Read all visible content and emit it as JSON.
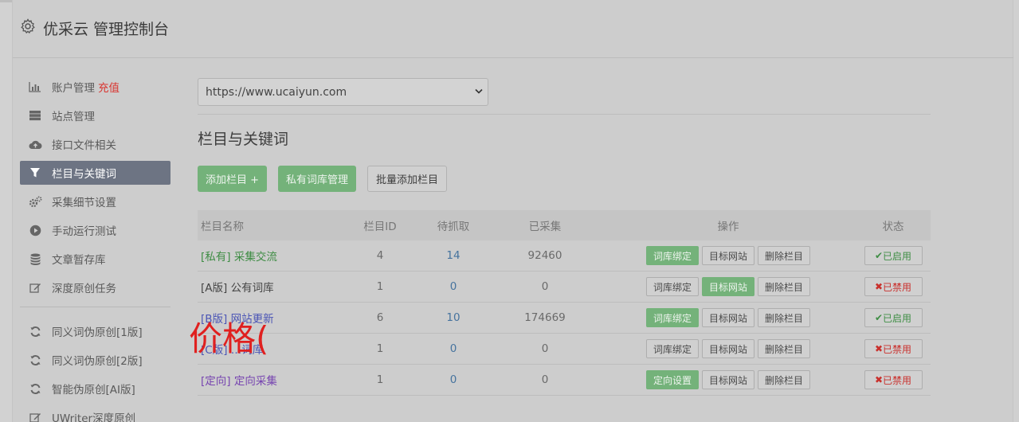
{
  "header": {
    "title": "优采云 管理控制台",
    "icon": "gear-icon"
  },
  "sidebar": {
    "items": [
      {
        "label": "账户管理",
        "extra": "充值",
        "icon": "bar-chart-icon"
      },
      {
        "label": "站点管理",
        "icon": "server-icon"
      },
      {
        "label": "接口文件相关",
        "icon": "cloud-upload-icon"
      },
      {
        "label": "栏目与关键词",
        "icon": "filter-icon",
        "active": true
      },
      {
        "label": "采集细节设置",
        "icon": "cogs-icon"
      },
      {
        "label": "手动运行测试",
        "icon": "play-circle-icon"
      },
      {
        "label": "文章暂存库",
        "icon": "database-icon"
      },
      {
        "label": "深度原创任务",
        "icon": "edit-icon"
      }
    ],
    "items2": [
      {
        "label": "同义词伪原创[1版]",
        "icon": "refresh-icon"
      },
      {
        "label": "同义词伪原创[2版]",
        "icon": "refresh-icon"
      },
      {
        "label": "智能伪原创[AI版]",
        "icon": "refresh-icon"
      },
      {
        "label": "UWriter深度原创",
        "icon": "edit-icon"
      }
    ]
  },
  "main": {
    "site_select": "https://www.ucaiyun.com",
    "section_title": "栏目与关键词",
    "buttons": {
      "add": "添加栏目 +",
      "private_lib": "私有词库管理",
      "batch_add": "批量添加栏目"
    },
    "table": {
      "headers": {
        "name": "栏目名称",
        "id": "栏目ID",
        "wait": "待抓取",
        "done": "已采集",
        "ops": "操作",
        "status": "状态"
      },
      "rows": [
        {
          "tag": "[私有]",
          "name": "采集交流",
          "id": "4",
          "wait": "14",
          "done": "92460",
          "op1": "词库绑定",
          "op2": "目标网站",
          "op3": "删除栏目",
          "status": "已启用"
        },
        {
          "tag": "[A版]",
          "name": "公有词库",
          "id": "1",
          "wait": "0",
          "done": "0",
          "op1": "词库绑定",
          "op2": "目标网站",
          "op3": "删除栏目",
          "status": "已禁用"
        },
        {
          "tag": "[B版]",
          "name": "网站更新",
          "id": "6",
          "wait": "10",
          "done": "174669",
          "op1": "词库绑定",
          "op2": "目标网站",
          "op3": "删除栏目",
          "status": "已启用"
        },
        {
          "tag": "[C版]",
          "name": "…词库",
          "id": "1",
          "wait": "0",
          "done": "0",
          "op1": "词库绑定",
          "op2": "目标网站",
          "op3": "删除栏目",
          "status": "已禁用"
        },
        {
          "tag": "[定向]",
          "name": "定向采集",
          "id": "1",
          "wait": "0",
          "done": "0",
          "op1": "定向设置",
          "op2": "目标网站",
          "op3": "删除栏目",
          "status": "已禁用"
        }
      ]
    }
  },
  "overlay": "价格(",
  "colors": {
    "green": "#74b27a",
    "active_nav": "#6d7483",
    "red": "#c9302c",
    "overlay_red": "#e0201f"
  }
}
